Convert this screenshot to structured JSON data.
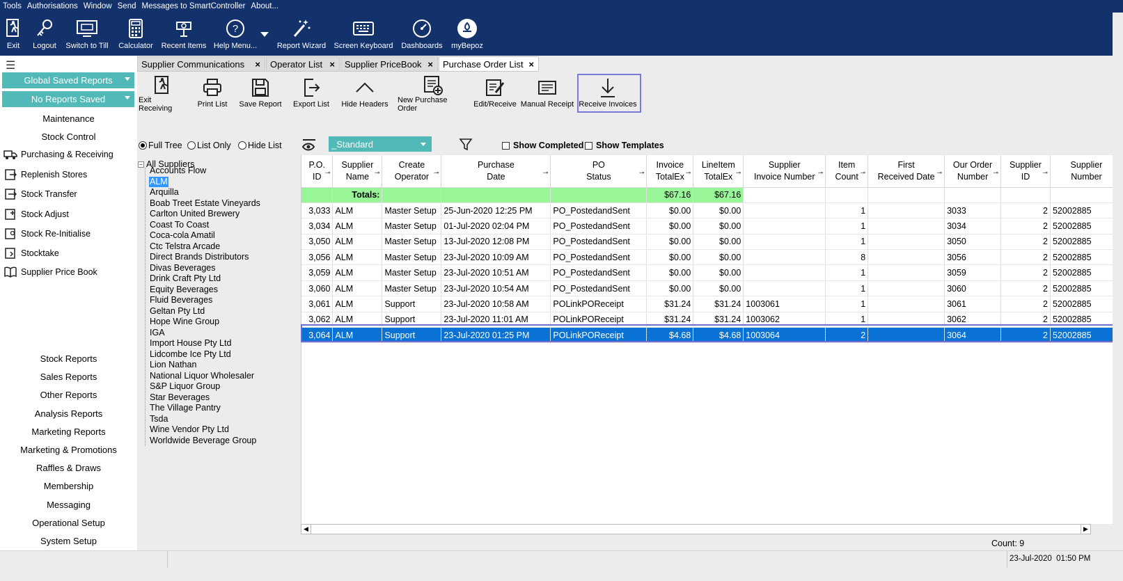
{
  "menubar": [
    "Tools",
    "Authorisations",
    "Window",
    "Send",
    "Messages to SmartController",
    "About..."
  ],
  "toolbar": [
    {
      "label": "Exit",
      "icon": "exit-icon"
    },
    {
      "label": "Logout",
      "icon": "key-icon"
    },
    {
      "label": "Switch to Till",
      "icon": "till-icon"
    },
    {
      "label": "Calculator",
      "icon": "calculator-icon"
    },
    {
      "label": "Recent Items",
      "icon": "recent-icon"
    },
    {
      "label": "Help Menu...",
      "icon": "help-icon"
    },
    {
      "label": "Report Wizard",
      "icon": "wand-icon"
    },
    {
      "label": "Screen Keyboard",
      "icon": "keyboard-icon"
    },
    {
      "label": "Dashboards",
      "icon": "gauge-icon"
    },
    {
      "label": "myBepoz",
      "icon": "bepoz-icon"
    }
  ],
  "left": {
    "global_reports": "Global Saved Reports",
    "no_reports": "No Reports Saved",
    "maintenance": "Maintenance",
    "stock_control": "Stock Control",
    "nav": [
      "Purchasing & Receiving",
      "Replenish Stores",
      "Stock Transfer",
      "Stock Adjust",
      "Stock Re-Initialise",
      "Stocktake",
      "Supplier Price Book"
    ],
    "reports": [
      "Stock Reports",
      "Sales Reports",
      "Other Reports",
      "Analysis Reports",
      "Marketing Reports",
      "Marketing & Promotions",
      "Raffles & Draws",
      "Membership",
      "Messaging",
      "Operational Setup",
      "System Setup"
    ]
  },
  "tabs": [
    "Supplier Communications",
    "Operator List",
    "Supplier PriceBook",
    "Purchase Order List"
  ],
  "close_glyph": "×",
  "actions": [
    "Exit Receiving",
    "Print List",
    "Save Report",
    "Export List",
    "Hide Headers",
    "New Purchase Order",
    "Edit/Receive",
    "Manual Receipt",
    "Receive Invoices"
  ],
  "filters": {
    "full_tree": "Full Tree",
    "list_only": "List Only",
    "hide_list": "Hide List",
    "layout": "_Standard",
    "show_completed": "Show Completed",
    "show_templates": "Show Templates"
  },
  "tree": {
    "root": "All Suppliers",
    "items": [
      "Accounts Flow",
      "ALM",
      "Arquilla",
      "Boab Treet Estate Vineyards",
      "Carlton United Brewery",
      "Coast To Coast",
      "Coca-cola Amatil",
      "Ctc Telstra Arcade",
      "Direct Brands Distributors",
      "Divas Beverages",
      "Drink Craft Pty Ltd",
      "Equity Beverages",
      "Fluid Beverages",
      "Geltan Pty Ltd",
      "Hope Wine Group",
      "IGA",
      "Import House Pty Ltd",
      "Lidcombe Ice Pty Ltd",
      "Lion Nathan",
      "National Liquor Wholesaler",
      "S&P Liquor Group",
      "Star Beverages",
      "The Village Pantry",
      "Tsda",
      "Wine Vendor Pty Ltd",
      "Worldwide Beverage Group"
    ]
  },
  "grid": {
    "columns": [
      [
        "P.O.",
        "ID"
      ],
      [
        "Supplier",
        "Name"
      ],
      [
        "Create",
        "Operator"
      ],
      [
        "Purchase",
        "Date"
      ],
      [
        "PO",
        "Status"
      ],
      [
        "Invoice",
        "TotalEx"
      ],
      [
        "LineItem",
        "TotalEx"
      ],
      [
        "Supplier",
        "Invoice Number"
      ],
      [
        "Item",
        "Count"
      ],
      [
        "First",
        "Received Date"
      ],
      [
        "Our Order",
        "Number"
      ],
      [
        "Supplier",
        "ID"
      ],
      [
        "Supplier",
        "Number"
      ]
    ],
    "totals_label": "Totals:",
    "totals_invoice": "$67.16",
    "totals_lineitem": "$67.16",
    "rows": [
      [
        "3,033",
        "ALM",
        "Master Setup",
        "25-Jun-2020 12:25 PM",
        "PO_PostedandSent",
        "$0.00",
        "$0.00",
        "",
        "1",
        "",
        "3033",
        "2",
        "52002885"
      ],
      [
        "3,034",
        "ALM",
        "Master Setup",
        "01-Jul-2020 02:04 PM",
        "PO_PostedandSent",
        "$0.00",
        "$0.00",
        "",
        "1",
        "",
        "3034",
        "2",
        "52002885"
      ],
      [
        "3,050",
        "ALM",
        "Master Setup",
        "13-Jul-2020 12:08 PM",
        "PO_PostedandSent",
        "$0.00",
        "$0.00",
        "",
        "1",
        "",
        "3050",
        "2",
        "52002885"
      ],
      [
        "3,056",
        "ALM",
        "Master Setup",
        "23-Jul-2020 10:09 AM",
        "PO_PostedandSent",
        "$0.00",
        "$0.00",
        "",
        "8",
        "",
        "3056",
        "2",
        "52002885"
      ],
      [
        "3,059",
        "ALM",
        "Master Setup",
        "23-Jul-2020 10:51 AM",
        "PO_PostedandSent",
        "$0.00",
        "$0.00",
        "",
        "1",
        "",
        "3059",
        "2",
        "52002885"
      ],
      [
        "3,060",
        "ALM",
        "Master Setup",
        "23-Jul-2020 10:54 AM",
        "PO_PostedandSent",
        "$0.00",
        "$0.00",
        "",
        "1",
        "",
        "3060",
        "2",
        "52002885"
      ],
      [
        "3,061",
        "ALM",
        "Support",
        "23-Jul-2020 10:58 AM",
        "POLinkPOReceipt",
        "$31.24",
        "$31.24",
        "1003061",
        "1",
        "",
        "3061",
        "2",
        "52002885"
      ],
      [
        "3,062",
        "ALM",
        "Support",
        "23-Jul-2020 11:01 AM",
        "POLinkPOReceipt",
        "$31.24",
        "$31.24",
        "1003062",
        "1",
        "",
        "3062",
        "2",
        "52002885"
      ],
      [
        "3,064",
        "ALM",
        "Support",
        "23-Jul-2020 01:25 PM",
        "POLinkPOReceipt",
        "$4.68",
        "$4.68",
        "1003064",
        "2",
        "",
        "3064",
        "2",
        "52002885"
      ]
    ]
  },
  "count": "Count: 9",
  "status": {
    "date": "23-Jul-2020",
    "time": "01:50 PM"
  }
}
